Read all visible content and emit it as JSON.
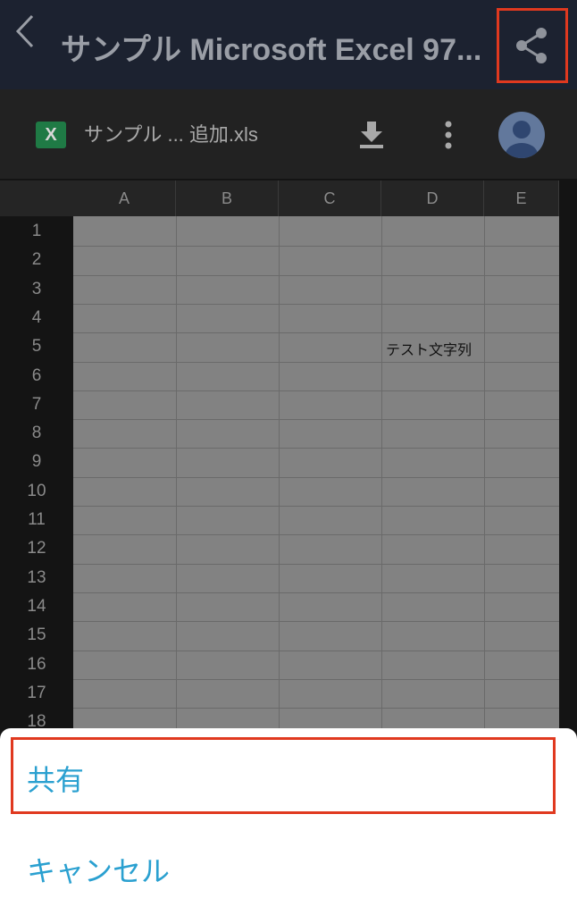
{
  "appbar": {
    "title": "サンプル Microsoft Excel 97...",
    "back_icon": "chevron-left-icon",
    "share_icon": "share-icon"
  },
  "doc_toolbar": {
    "file_badge": "X",
    "file_name": "サンプル ... 追加.xls",
    "download_icon": "download-icon",
    "more_icon": "more-vert-icon",
    "avatar_icon": "account-avatar-icon"
  },
  "sheet": {
    "columns": [
      "A",
      "B",
      "C",
      "D",
      "E"
    ],
    "rows": [
      "1",
      "2",
      "3",
      "4",
      "5",
      "6",
      "7",
      "8",
      "9",
      "10",
      "11",
      "12",
      "13",
      "14",
      "15",
      "16",
      "17",
      "18"
    ],
    "cell_D5": "テスト文字列"
  },
  "bottom_sheet": {
    "share_label": "共有",
    "cancel_label": "キャンセル"
  },
  "colors": {
    "highlight": "#e0391f",
    "option_text": "#2aa0d0",
    "excel_green": "#1f7a45"
  }
}
